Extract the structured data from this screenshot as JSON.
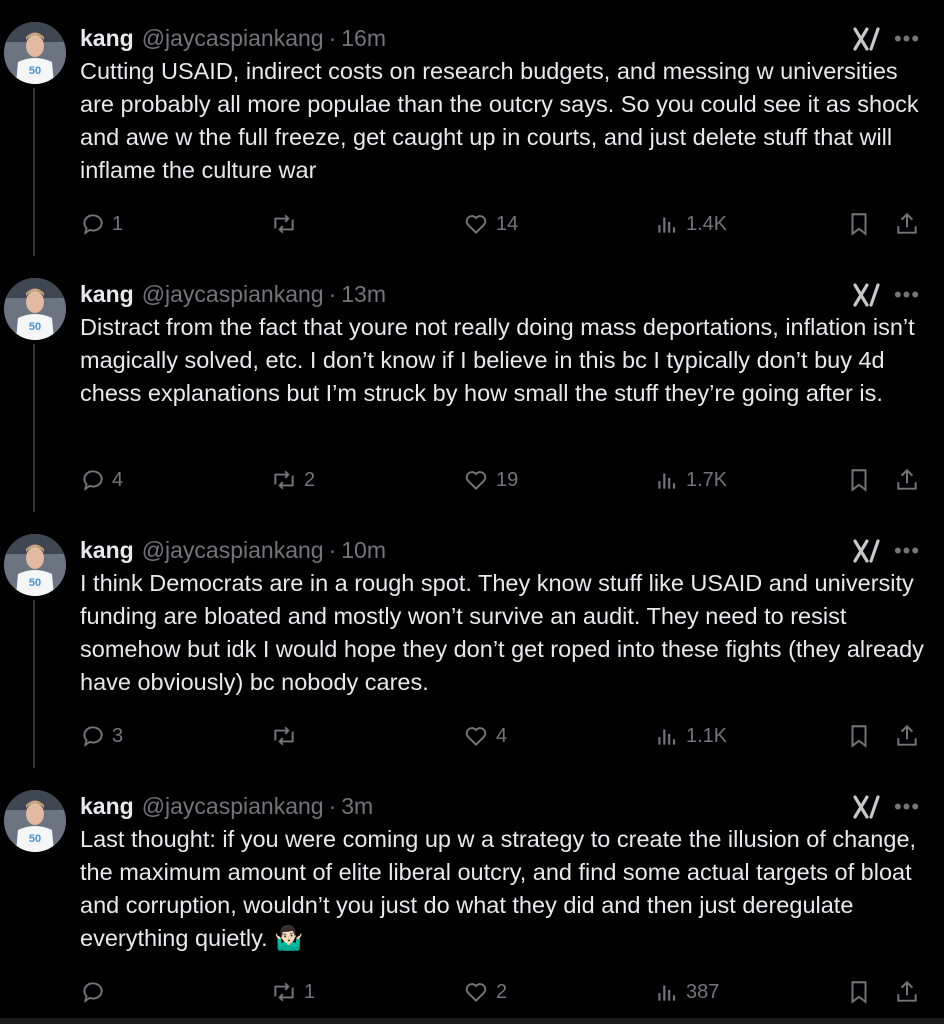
{
  "tweets": [
    {
      "name": "kang",
      "handle": "@jaycaspiankang",
      "separator": "·",
      "time": "16m",
      "text": "Cutting USAID, indirect costs on research budgets, and messing w universities are probably all more populae than the outcry says. So you could see it as shock and awe w the full freeze, get caught up in courts, and just delete stuff that will inflame the culture war",
      "replies": "1",
      "reposts": "",
      "likes": "14",
      "views": "1.4K"
    },
    {
      "name": "kang",
      "handle": "@jaycaspiankang",
      "separator": "·",
      "time": "13m",
      "text": "Distract from the fact that youre not really doing mass deportations, inflation isn’t magically solved, etc. I don’t know if I believe in this bc I typically don’t buy 4d chess explanations but I’m struck by how small the stuff they’re going after is.",
      "replies": "4",
      "reposts": "2",
      "likes": "19",
      "views": "1.7K"
    },
    {
      "name": "kang",
      "handle": "@jaycaspiankang",
      "separator": "·",
      "time": "10m",
      "text": "I think Democrats are in a rough spot. They know stuff like USAID and university funding are bloated and mostly won’t survive an audit. They need to resist somehow but idk I would hope they don’t get roped into these fights (they already have obviously) bc nobody cares.",
      "replies": "3",
      "reposts": "",
      "likes": "4",
      "views": "1.1K"
    },
    {
      "name": "kang",
      "handle": "@jaycaspiankang",
      "separator": "·",
      "time": "3m",
      "text": "Last thought: if you were coming up w a strategy to create the illusion of change, the maximum amount of elite liberal outcry, and find some actual targets of bloat and corruption, wouldn’t you just do what they did and then just deregulate everything quietly. 🤷🏻‍♂️",
      "replies": "",
      "reposts": "1",
      "likes": "2",
      "views": "387"
    }
  ],
  "icons": {
    "reply": "reply-icon",
    "repost": "repost-icon",
    "like": "like-icon",
    "views": "views-icon",
    "bookmark": "bookmark-icon",
    "share": "share-icon",
    "grok": "grok-icon",
    "more": "more-icon"
  },
  "colors": {
    "background": "#000000",
    "text": "#e7e9ea",
    "muted": "#71767b",
    "thread_line": "#333639"
  }
}
